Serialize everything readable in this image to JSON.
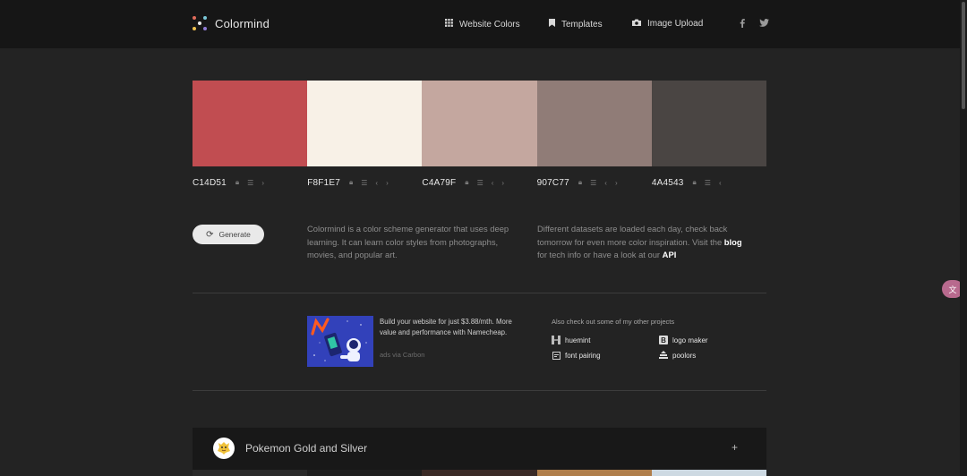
{
  "nav": {
    "brand": "Colormind",
    "links": [
      {
        "label": "Website Colors",
        "icon": "grid-icon"
      },
      {
        "label": "Templates",
        "icon": "bookmark-icon"
      },
      {
        "label": "Image Upload",
        "icon": "camera-icon"
      }
    ],
    "social": [
      "facebook-icon",
      "twitter-icon"
    ]
  },
  "palette": {
    "colors": [
      "#C14D51",
      "#F8F1E7",
      "#C4A79F",
      "#907C77",
      "#4A4543"
    ],
    "codes": [
      "C14D51",
      "F8F1E7",
      "C4A79F",
      "907C77",
      "4A4543"
    ]
  },
  "generate": {
    "label": "Generate"
  },
  "intro": {
    "left": "Colormind is a color scheme generator that uses deep learning. It can learn color styles from photographs, movies, and popular art.",
    "right_pre": "Different datasets are loaded each day, check back tomorrow for even more color inspiration. Visit the",
    "right_blog": "blog",
    "right_mid": "for tech info or have a look at our",
    "right_api": "API"
  },
  "ad": {
    "text": "Build your website for just $3.88/mth. More value and performance with Namecheap.",
    "via": "ads via Carbon"
  },
  "projects": {
    "title": "Also check out some of my other projects",
    "items": [
      {
        "label": "huemint",
        "icon": "huemint-icon"
      },
      {
        "label": "logo maker",
        "icon": "logo-maker-icon"
      },
      {
        "label": "font pairing",
        "icon": "font-pairing-icon"
      },
      {
        "label": "poolors",
        "icon": "poolors-icon"
      }
    ]
  },
  "card": {
    "title": "Pokemon Gold and Silver",
    "expand": "+",
    "colors": [
      "#2a2a2a",
      "#1f1f1f",
      "#3a2a26",
      "#b07e4a",
      "#cdd9e2"
    ]
  },
  "accent": "#b86a8e"
}
